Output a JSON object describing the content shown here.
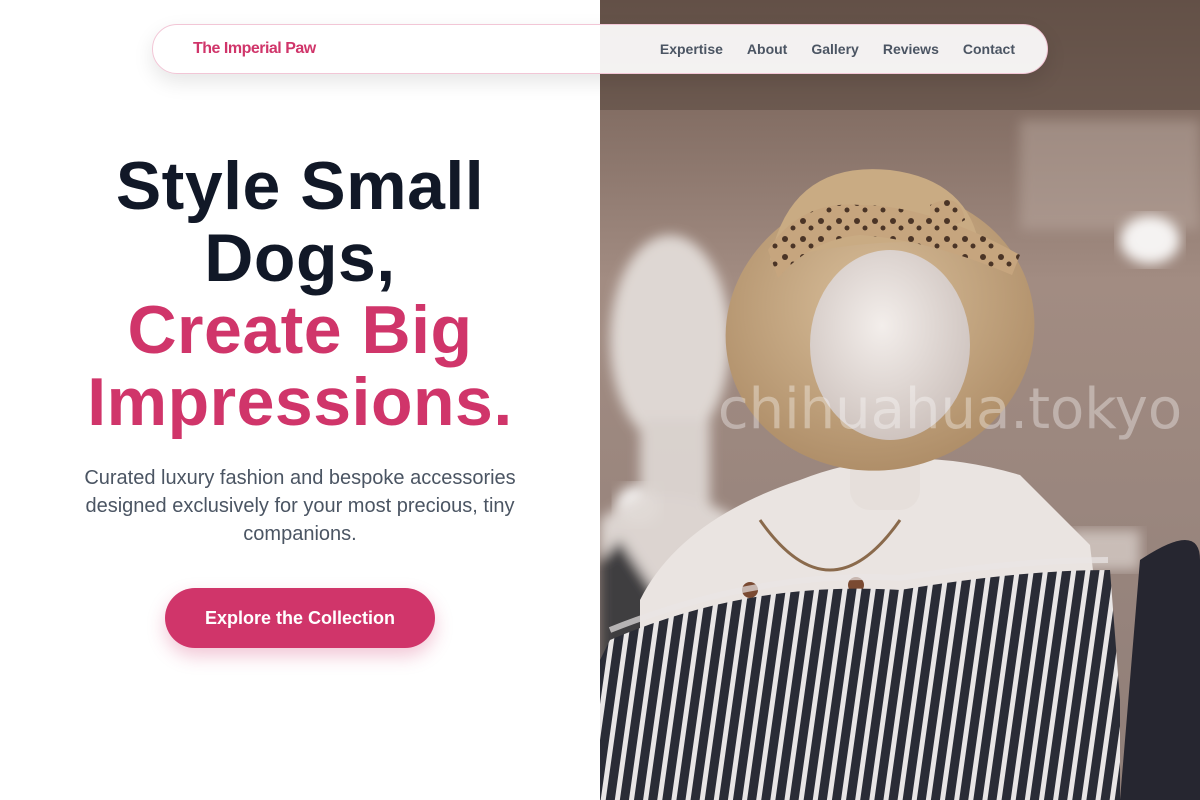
{
  "navbar": {
    "brand": "The Imperial Paw",
    "links": [
      "Expertise",
      "About",
      "Gallery",
      "Reviews",
      "Contact"
    ]
  },
  "hero": {
    "headline_dark": [
      "Style Small",
      "Dogs,"
    ],
    "headline_accent": [
      "Create Big",
      "Impressions."
    ],
    "subtitle": "Curated luxury fashion and bespoke accessories designed exclusively for your most precious, tiny companions.",
    "cta_label": "Explore the Collection"
  },
  "image": {
    "watermark": "chihuahua.tokyo"
  },
  "colors": {
    "accent": "#d0356a",
    "heading": "#111827",
    "body_text": "#4b5563"
  }
}
